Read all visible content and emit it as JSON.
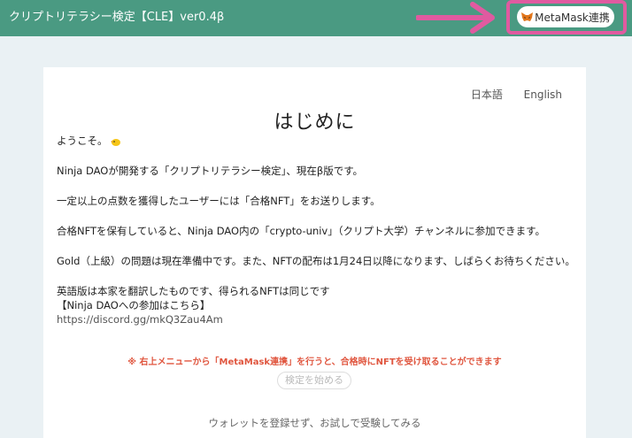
{
  "header": {
    "title": "クリプトリテラシー検定【CLE】ver0.4β",
    "metamask_label": "MetaMask連携"
  },
  "lang": {
    "ja": "日本語",
    "en": "English"
  },
  "page": {
    "title": "はじめに",
    "paragraphs": [
      "ようこそ。",
      "Ninja DAOが開発する「クリプトリテラシー検定」、現在β版です。",
      "一定以上の点数を獲得したユーザーには「合格NFT」をお送りします。",
      "合格NFTを保有していると、Ninja DAO内の「crypto-univ」（クリプト大学）チャンネルに参加できます。",
      "Gold（上級）の問題は現在準備中です。また、NFTの配布は1月24日以降になります、しばらくお待ちください。",
      "英語版は本家を翻訳したものです、得られるNFTは同じです",
      "【Ninja DAOへの参加はこちら】",
      "https://discord.gg/mkQ3Zau4Am"
    ],
    "notice": "※ 右上メニューから「MetaMask連携」を行うと、合格時にNFTを受け取ることができます",
    "start_label": "検定を始める",
    "trial_label": "ウォレットを登録せず、お試しで受験してみる"
  },
  "colors": {
    "header_bg": "#4a9a82",
    "highlight": "#e05aa0",
    "notice": "#e0563f"
  }
}
